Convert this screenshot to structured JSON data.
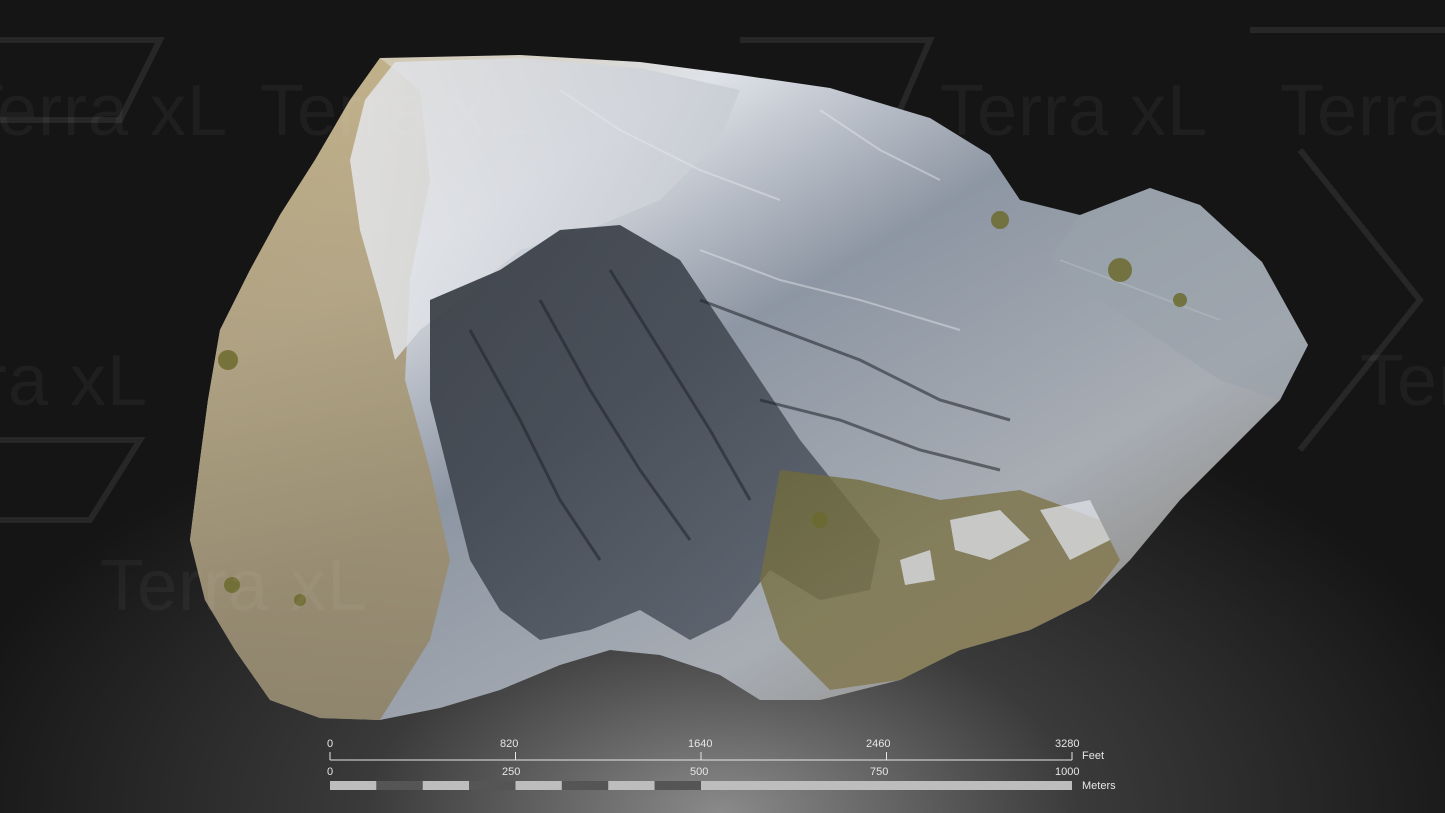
{
  "watermark": {
    "text": "Terra xL"
  },
  "scene": {
    "subject": "terrain-model",
    "colors": {
      "background_dark": "#151515",
      "background_glow": "#8a8a8a",
      "rock_light": "#d9dde3",
      "rock_mid": "#8d96a3",
      "rock_shadow": "#3b4048",
      "rock_tan": "#b8a27a",
      "vegetation": "#6c6a2e"
    }
  },
  "scale_bar": {
    "feet": {
      "unit": "Feet",
      "ticks": [
        "0",
        "820",
        "1640",
        "2460",
        "3280"
      ]
    },
    "meters": {
      "unit": "Meters",
      "ticks": [
        "0",
        "250",
        "500",
        "750",
        "1000"
      ]
    },
    "segment_colors": {
      "light": "#bdbdbd",
      "dark": "#555555"
    }
  }
}
